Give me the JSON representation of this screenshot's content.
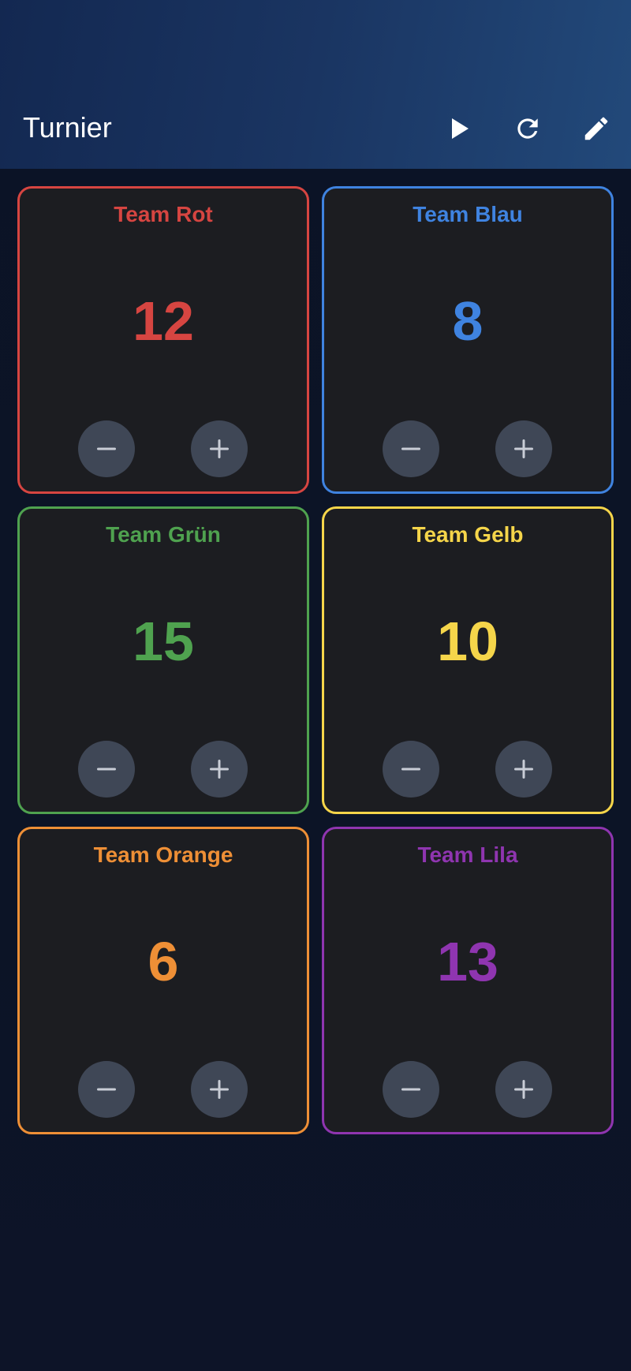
{
  "app": {
    "title": "Turnier",
    "actions": [
      {
        "name": "play-icon"
      },
      {
        "name": "refresh-icon"
      },
      {
        "name": "edit-icon"
      }
    ]
  },
  "teams": [
    {
      "name": "Team Rot",
      "score": "12",
      "color": "#d64541"
    },
    {
      "name": "Team Blau",
      "score": "8",
      "color": "#3f83e0"
    },
    {
      "name": "Team Grün",
      "score": "15",
      "color": "#4fa24f"
    },
    {
      "name": "Team Gelb",
      "score": "10",
      "color": "#f5d54a"
    },
    {
      "name": "Team Orange",
      "score": "6",
      "color": "#ee8f36"
    },
    {
      "name": "Team Lila",
      "score": "13",
      "color": "#8f35b0"
    }
  ],
  "controls": {
    "decrement_icon": "minus-icon",
    "increment_icon": "plus-icon"
  }
}
